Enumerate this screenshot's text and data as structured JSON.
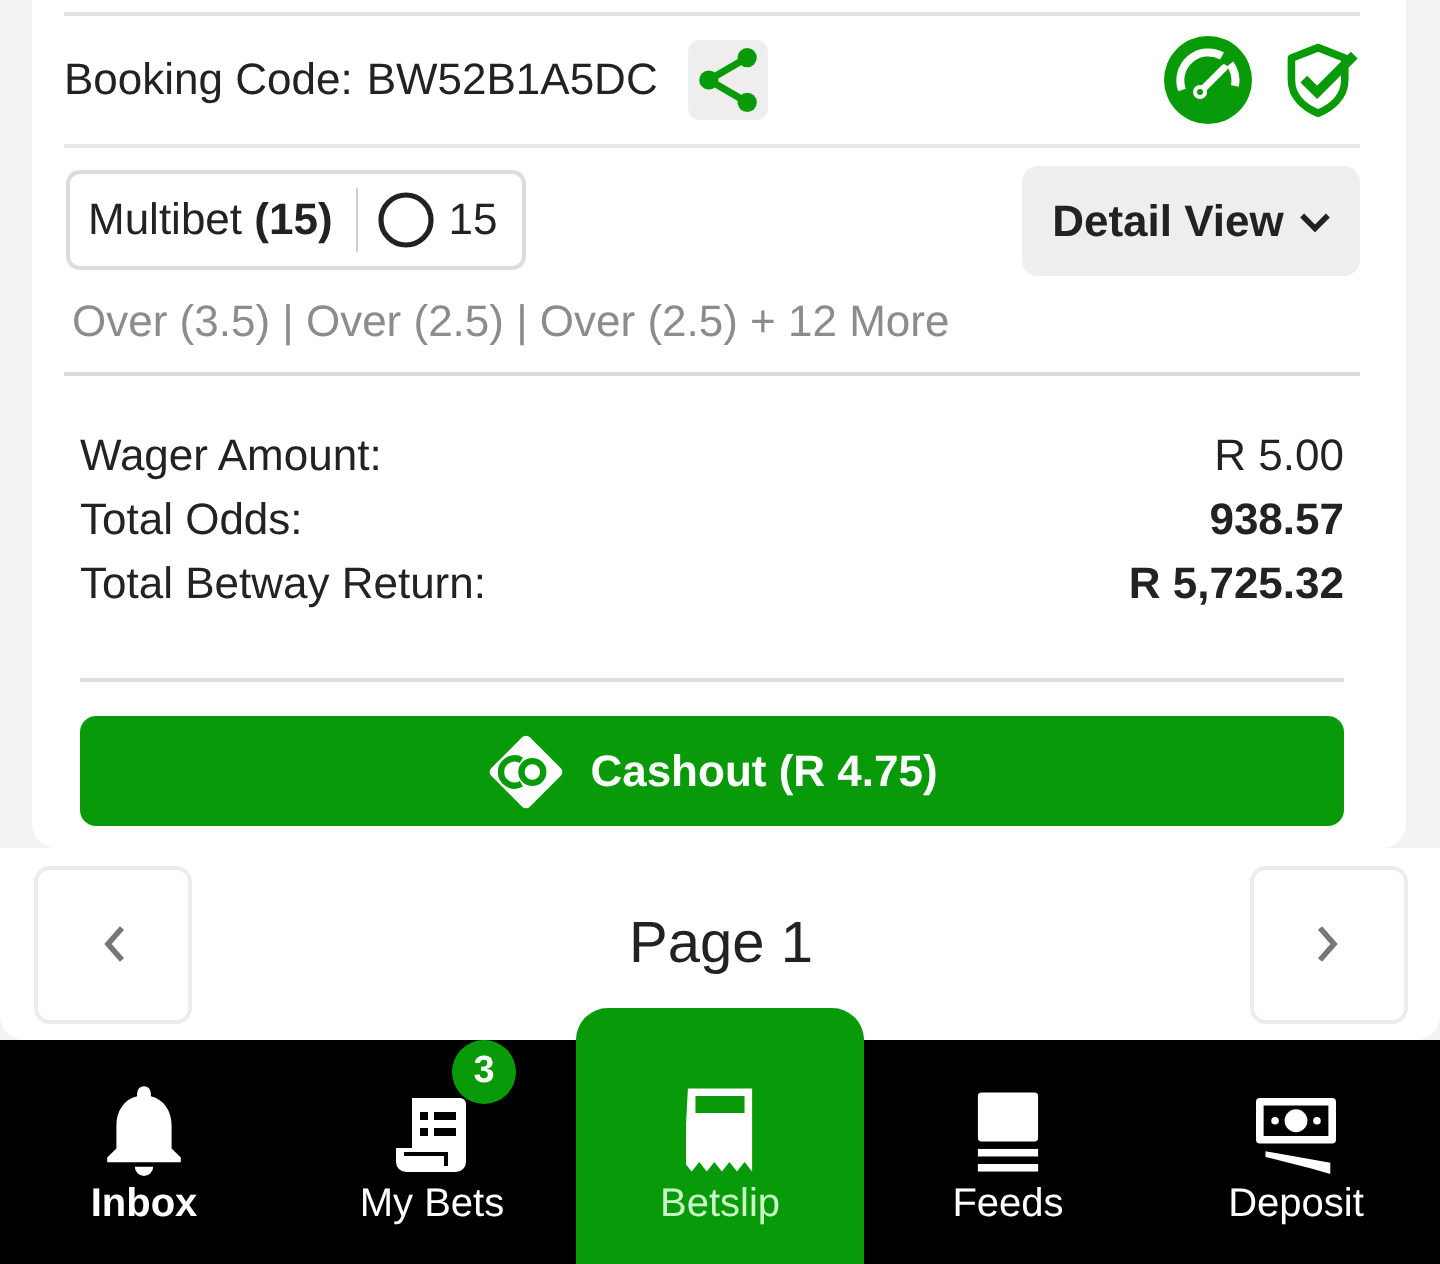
{
  "booking": {
    "label": "Booking Code:",
    "code": "BW52B1A5DC"
  },
  "bet_summary": {
    "type_label": "Multibet **(15)**",
    "selection_count": "15"
  },
  "view_button": {
    "label": "Detail View"
  },
  "selections_preview": "Over (3.5) | Over (2.5) | Over (2.5) + 12 More",
  "totals": [
    {
      "label": "Wager Amount:",
      "value": "R 5.00",
      "kind": "plain"
    },
    {
      "label": "Total Odds:",
      "value": "938.57",
      "kind": "strong"
    },
    {
      "label": "Total Betway Return:",
      "value": "R 5,725.32",
      "kind": "strong"
    }
  ],
  "cashout_button": {
    "label": "Cashout (R 4.75)"
  },
  "pager": {
    "label": "Page 1"
  },
  "nav": [
    {
      "label": "Inbox",
      "selected": false,
      "emphasized": true
    },
    {
      "label": "My Bets",
      "selected": false,
      "emphasized": false,
      "badge": "3"
    },
    {
      "label": "Betslip",
      "selected": true,
      "emphasized": false
    },
    {
      "label": "Feeds",
      "selected": false,
      "emphasized": false
    },
    {
      "label": "Deposit",
      "selected": false,
      "emphasized": false
    }
  ]
}
